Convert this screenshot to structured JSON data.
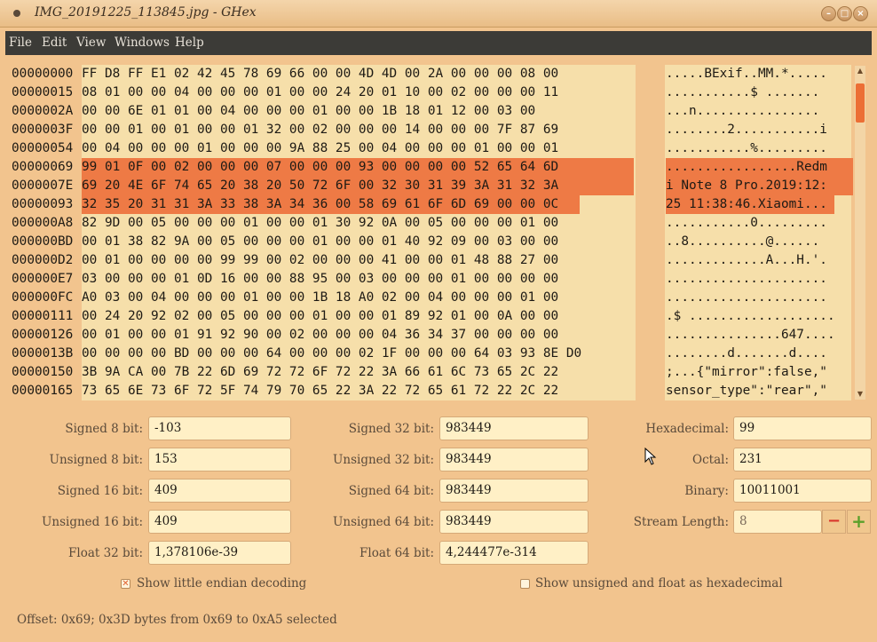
{
  "window": {
    "title": "IMG_20191225_113845.jpg - GHex"
  },
  "menu": [
    "File",
    "Edit",
    "View",
    "Windows",
    "Help"
  ],
  "hex": {
    "rows": [
      {
        "addr": "00000000",
        "hex": "FF D8 FF E1 02 42 45 78 69 66 00 00 4D 4D 00 2A 00 00 00 08 00",
        "ascii": ".....BExif..MM.*....."
      },
      {
        "addr": "00000015",
        "hex": "08 01 00 00 04 00 00 00 01 00 00 24 20 01 10 00 02 00 00 00 11",
        "ascii": "...........$ ......."
      },
      {
        "addr": "0000002A",
        "hex": "00 00 6E 01 01 00 04 00 00 00 01 00 00 1B 18 01 12 00 03 00",
        "ascii": "...n................"
      },
      {
        "addr": "0000003F",
        "hex": "00 00 01 00 01 00 00 01 32 00 02 00 00 00 14 00 00 00 7F 87 69",
        "ascii": "........2...........i"
      },
      {
        "addr": "00000054",
        "hex": "00 04 00 00 00 01 00 00 00 9A 88 25 00 04 00 00 00 01 00 00 01",
        "ascii": "...........%........."
      },
      {
        "addr": "00000069",
        "hex": "99 01 0F 00 02 00 00 00 07 00 00 00 93 00 00 00 00 52 65 64 6D",
        "ascii": ".................Redm"
      },
      {
        "addr": "0000007E",
        "hex": "69 20 4E 6F 74 65 20 38 20 50 72 6F 00 32 30 31 39 3A 31 32 3A",
        "ascii": "i Note 8 Pro.2019:12:"
      },
      {
        "addr": "00000093",
        "hex": "32 35 20 31 31 3A 33 38 3A 34 36 00 58 69 61 6F 6D 69 00 00 0C",
        "ascii": "25 11:38:46.Xiaomi..."
      },
      {
        "addr": "000000A8",
        "hex": "82 9D 00 05 00 00 00 01 00 00 01 30 92 0A 00 05 00 00 00 01 00",
        "ascii": "...........0........."
      },
      {
        "addr": "000000BD",
        "hex": "00 01 38 82 9A 00 05 00 00 00 01 00 00 01 40 92 09 00 03 00 00",
        "ascii": "..8..........@......"
      },
      {
        "addr": "000000D2",
        "hex": "00 01 00 00 00 00 99 99 00 02 00 00 00 41 00 00 01 48 88 27 00",
        "ascii": ".............A...H.'."
      },
      {
        "addr": "000000E7",
        "hex": "03 00 00 00 01 0D 16 00 00 88 95 00 03 00 00 00 01 00 00 00 00",
        "ascii": "....................."
      },
      {
        "addr": "000000FC",
        "hex": "A0 03 00 04 00 00 00 01 00 00 1B 18 A0 02 00 04 00 00 00 01 00",
        "ascii": "....................."
      },
      {
        "addr": "00000111",
        "hex": "00 24 20 92 02 00 05 00 00 00 01 00 00 01 89 92 01 00 0A 00 00",
        "ascii": ".$ ..................."
      },
      {
        "addr": "00000126",
        "hex": "00 01 00 00 01 91 92 90 00 02 00 00 00 04 36 34 37 00 00 00 00",
        "ascii": "...............647...."
      },
      {
        "addr": "0000013B",
        "hex": "00 00 00 00 BD 00 00 00 64 00 00 00 02 1F 00 00 00 64 03 93 8E D0",
        "ascii": "........d.......d...."
      },
      {
        "addr": "00000150",
        "hex": "3B 9A CA 00 7B 22 6D 69 72 72 6F 72 22 3A 66 61 6C 73 65 2C 22",
        "ascii": ";...{\"mirror\":false,\""
      },
      {
        "addr": "00000165",
        "hex": "73 65 6E 73 6F 72 5F 74 79 70 65 22 3A 22 72 65 61 72 22 2C 22",
        "ascii": "sensor_type\":\"rear\",\""
      }
    ]
  },
  "fields": {
    "signed8": {
      "label": "Signed 8 bit:",
      "value": "-103"
    },
    "unsigned8": {
      "label": "Unsigned 8 bit:",
      "value": "153"
    },
    "signed16": {
      "label": "Signed 16 bit:",
      "value": "409"
    },
    "unsigned16": {
      "label": "Unsigned 16 bit:",
      "value": "409"
    },
    "float32": {
      "label": "Float 32 bit:",
      "value": "1,378106e-39"
    },
    "signed32": {
      "label": "Signed 32 bit:",
      "value": "983449"
    },
    "unsigned32": {
      "label": "Unsigned 32 bit:",
      "value": "983449"
    },
    "signed64": {
      "label": "Signed 64 bit:",
      "value": "983449"
    },
    "unsigned64": {
      "label": "Unsigned 64 bit:",
      "value": "983449"
    },
    "float64": {
      "label": "Float 64 bit:",
      "value": "4,244477e-314"
    },
    "hexadecimal": {
      "label": "Hexadecimal:",
      "value": "99"
    },
    "octal": {
      "label": "Octal:",
      "value": "231"
    },
    "binary": {
      "label": "Binary:",
      "value": "10011001"
    },
    "stream_length": {
      "label": "Stream Length:",
      "value": "8"
    }
  },
  "options": {
    "little_endian": {
      "label": "Show little endian decoding",
      "checked": true
    },
    "unsigned_hex": {
      "label": "Show unsigned and float as hexadecimal",
      "checked": false
    }
  },
  "status": {
    "text": "Offset: 0x69; 0x3D bytes from 0x69 to 0xA5 selected"
  },
  "colors": {
    "selection": "#ee7a45",
    "background": "#f2c48e",
    "menubar": "#3c3b37"
  }
}
